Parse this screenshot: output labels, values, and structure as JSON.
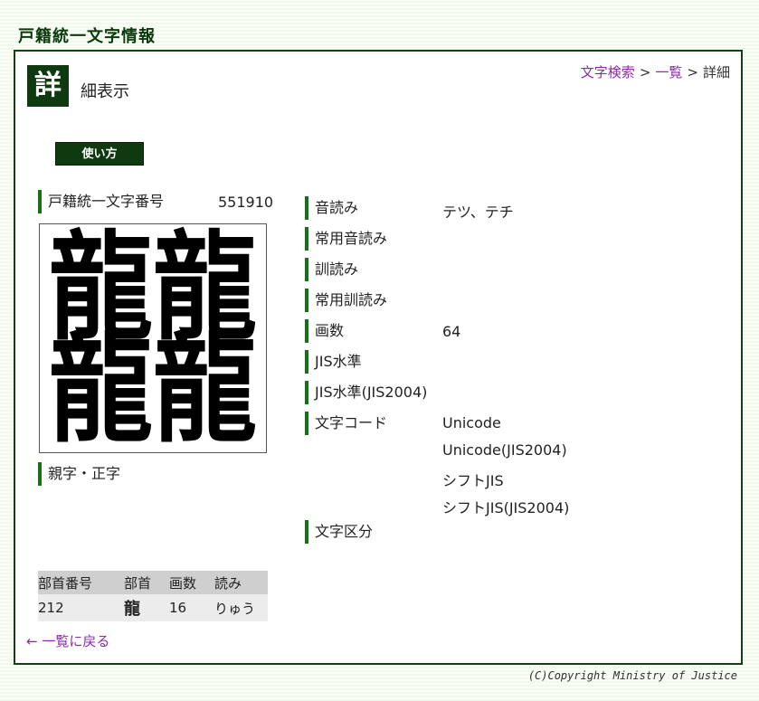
{
  "site": {
    "title": "戸籍統一文字情報"
  },
  "header": {
    "icon_char": "詳",
    "title_rest": "細表示",
    "breadcrumb": {
      "search": "文字検索",
      "list": "一覧",
      "current": "詳細",
      "sep": ">"
    },
    "usage_button": "使い方"
  },
  "left": {
    "number_label": "戸籍統一文字番号",
    "number_value": "551910",
    "glyph": [
      "龍龍",
      "龍龍"
    ],
    "parent_label": "親字・正字"
  },
  "attributes": [
    {
      "label": "音読み",
      "value": "テツ、テチ"
    },
    {
      "label": "常用音読み",
      "value": ""
    },
    {
      "label": "訓読み",
      "value": ""
    },
    {
      "label": "常用訓読み",
      "value": ""
    },
    {
      "label": "画数",
      "value": "64"
    },
    {
      "label": "JIS水準",
      "value": ""
    },
    {
      "label": "JIS水準(JIS2004)",
      "value": ""
    },
    {
      "label": "文字コード",
      "values": [
        "Unicode",
        "Unicode(JIS2004)",
        "シフトJIS",
        "シフトJIS(JIS2004)"
      ]
    },
    {
      "label": "文字区分",
      "value": ""
    }
  ],
  "radical_table": {
    "headers": [
      "部首番号",
      "部首",
      "画数",
      "読み"
    ],
    "row": [
      "212",
      "龍",
      "16",
      "りゅう"
    ]
  },
  "back_link": "← 一覧に戻る",
  "footer": {
    "copyright": "(C)Copyright Ministry of Justice"
  }
}
